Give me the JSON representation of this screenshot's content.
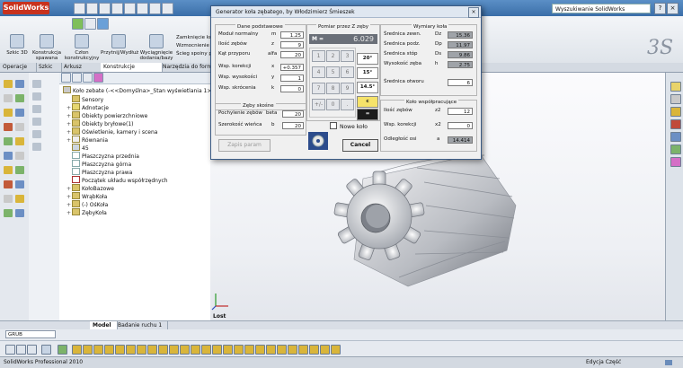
{
  "app": {
    "brand": "SolidWorks",
    "search_placeholder": "Wyszukiwanie SolidWorks"
  },
  "command_manager": {
    "buttons": [
      "Szkic 3D",
      "Konstrukcja spawana",
      "Człon konstrukcyjny",
      "Przytnij/Wydłuż",
      "Wyciągnięcie dodania/bazy"
    ],
    "small_buttons": [
      "Zamknięcie kor",
      "Wzmocnienie",
      "Ścieg spoiny pa"
    ]
  },
  "tabs": [
    "Operacje",
    "Szkic",
    "Arkusz blachy",
    "Konstrukcje spawane",
    "Narzędzia do form"
  ],
  "tree": {
    "root": "Koło zebate (-<<Domyślna>_Stan wyświetlania 1>)",
    "items": [
      {
        "label": "Sensory",
        "expand": ""
      },
      {
        "label": "Adnotacje",
        "expand": "+"
      },
      {
        "label": "Obiekty powierzchniowe",
        "expand": "+"
      },
      {
        "label": "Obiekty bryłowe(1)",
        "expand": "+"
      },
      {
        "label": "Oświetlenie, kamery i scena",
        "expand": "+"
      },
      {
        "label": "Równania",
        "expand": "+"
      },
      {
        "label": "45",
        "expand": ""
      },
      {
        "label": "Płaszczyzna przednia",
        "expand": ""
      },
      {
        "label": "Płaszczyzna górna",
        "expand": ""
      },
      {
        "label": "Płaszczyzna prawa",
        "expand": ""
      },
      {
        "label": "Początek układu współrzędnych",
        "expand": ""
      },
      {
        "label": "KołoBazowe",
        "expand": "+"
      },
      {
        "label": "WrąbKoła",
        "expand": "+"
      },
      {
        "label": "(-) OśKoła",
        "expand": "+"
      },
      {
        "label": "ZębyKoła",
        "expand": "+"
      }
    ]
  },
  "dialog": {
    "title": "Generator koła zębatego, by  Włodzimierz Śmieszek",
    "basic": {
      "title": "Dane podstawowe",
      "rows": [
        {
          "label": "Moduł normalny",
          "sym": "m",
          "value": "1.25"
        },
        {
          "label": "Ilość zębów",
          "sym": "z",
          "value": "9"
        },
        {
          "label": "Kąt przyporu",
          "sym": "alfa",
          "value": "20"
        },
        {
          "label": "Wsp. korekcji",
          "sym": "x",
          "value": "+0.357"
        },
        {
          "label": "Wsp. wysokości",
          "sym": "y",
          "value": "1"
        },
        {
          "label": "Wsp. skrócenia",
          "sym": "k",
          "value": "0"
        }
      ]
    },
    "helical": {
      "title": "Zęby skośne",
      "rows": [
        {
          "label": "Pochylenie zębów",
          "sym": "beta",
          "value": "20"
        },
        {
          "label": "Szerokość wieńca",
          "sym": "b",
          "value": "20"
        }
      ]
    },
    "save_button": "Zapis param",
    "measure": {
      "title": "Pomiar przez  Z zęby",
      "m_label": "M =",
      "m_value": "6.029"
    },
    "keypad": [
      "1",
      "2",
      "3",
      "4",
      "5",
      "6",
      "7",
      "8",
      "9",
      "+/-",
      "0",
      "."
    ],
    "angles": [
      "20°",
      "15°",
      "14.5°"
    ],
    "c_label": "c",
    "eq_label": "=",
    "new_wheel_label": "Nowe koło",
    "cancel_button": "Cancel",
    "wheel_dims": {
      "title": "Wymiary koła",
      "rows": [
        {
          "label": "Średnica zewn.",
          "sym": "Dz",
          "value": "15.36"
        },
        {
          "label": "Średnica podz.",
          "sym": "Dp",
          "value": "11.97"
        },
        {
          "label": "Średnica stóp",
          "sym": "Ds",
          "value": "9.86"
        },
        {
          "label": "Wysokość zęba",
          "sym": "h",
          "value": "2.75"
        }
      ],
      "bore": {
        "label": "Średnica otworu",
        "value": "6"
      }
    },
    "mating": {
      "title": "Koło współpracujące",
      "rows": [
        {
          "label": "Ilość zębów",
          "sym": "z2",
          "value": "12"
        },
        {
          "label": "Wsp. korekcji",
          "sym": "x2",
          "value": "0"
        },
        {
          "label": "Odległość osi",
          "sym": "a",
          "value": "14.414"
        }
      ]
    }
  },
  "viewport": {
    "view_label": "Lost"
  },
  "bottom_tabs": [
    "Model",
    "Badanie ruchu 1"
  ],
  "layer_select": "GRUB",
  "status": {
    "left": "SolidWorks Professional 2010",
    "right": "Edycja Część"
  }
}
